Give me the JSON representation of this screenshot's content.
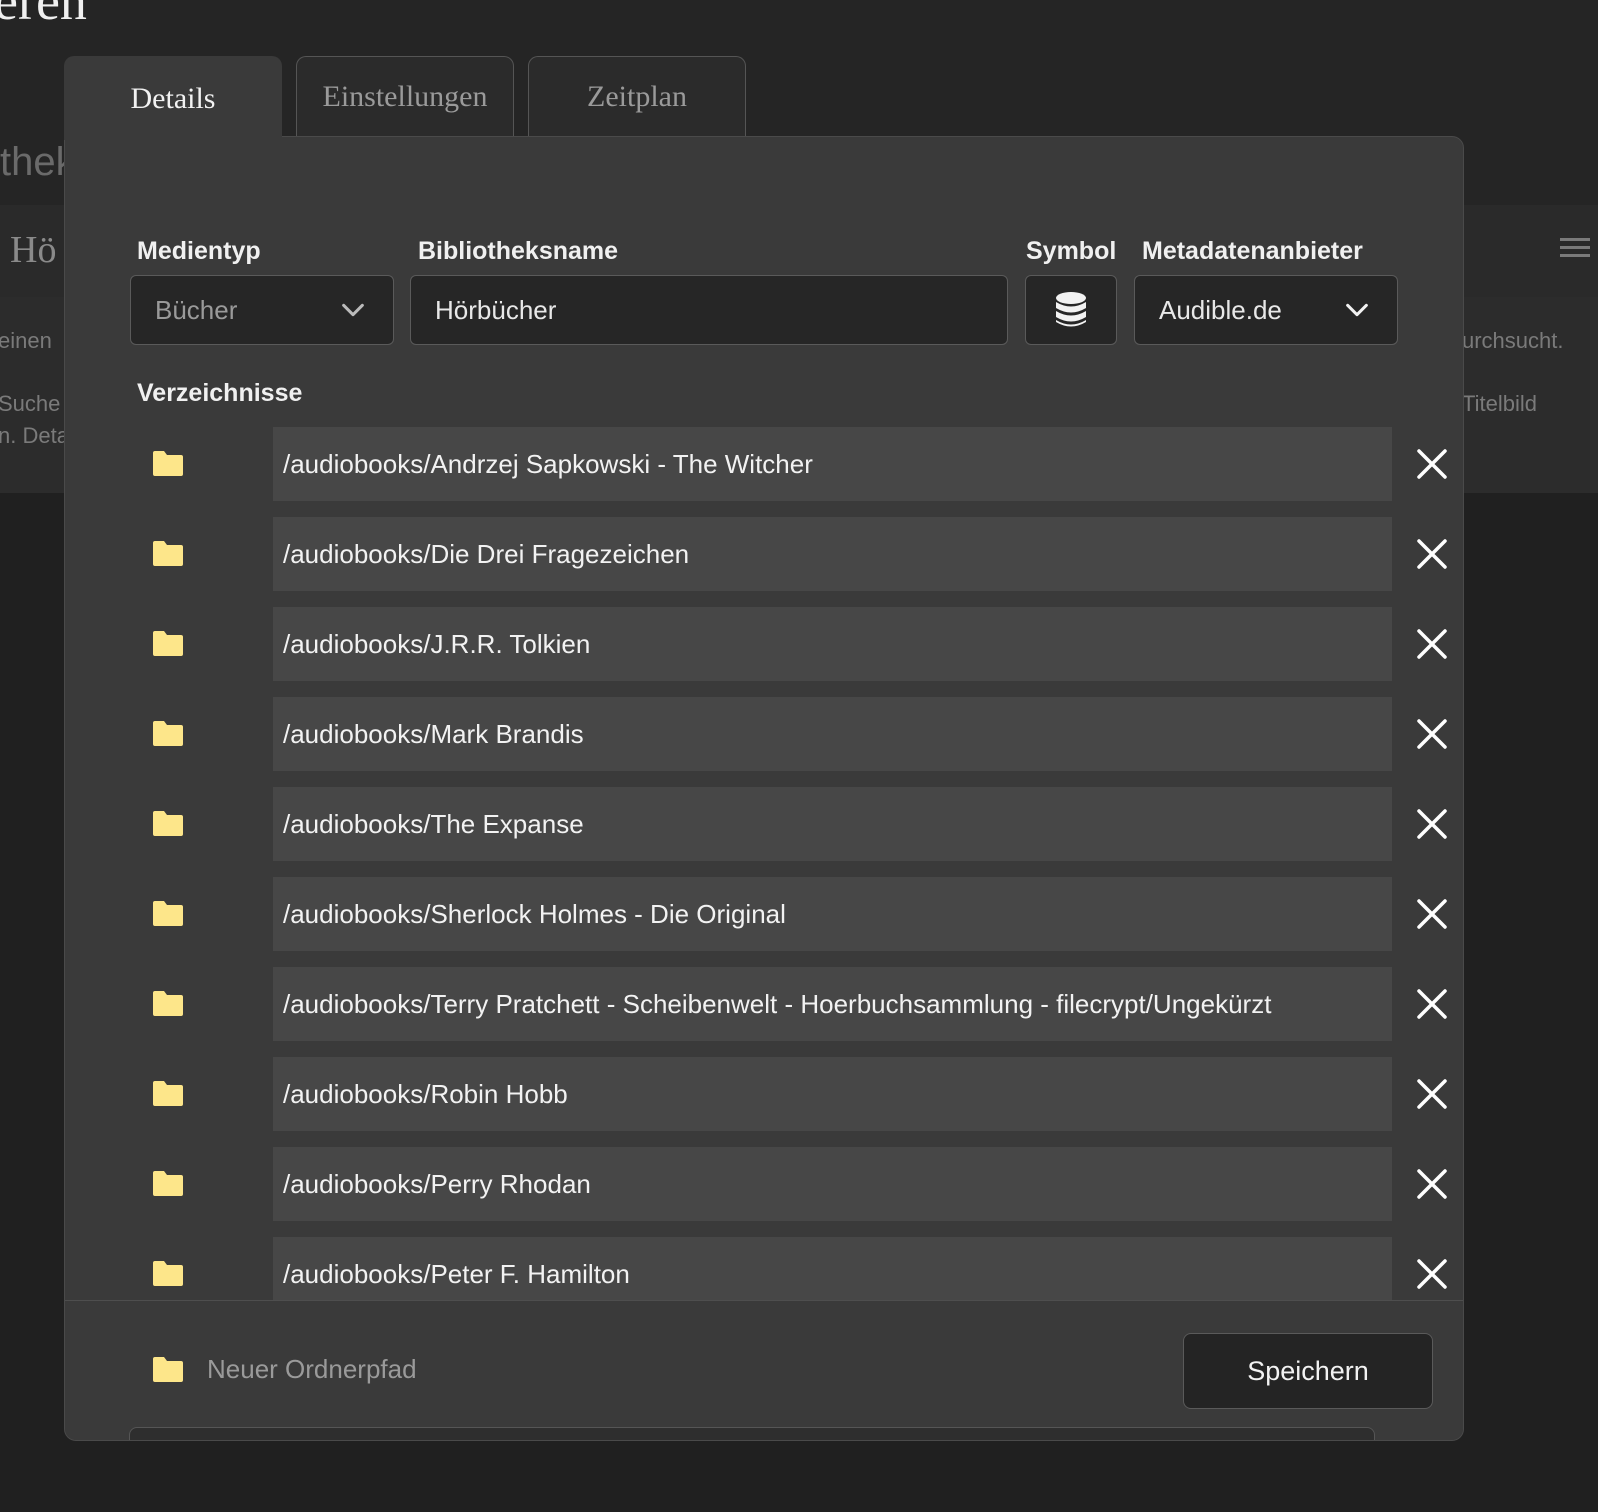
{
  "background": {
    "title": "eren",
    "subtitle": "thek",
    "row_label": "Hö",
    "text_left_1": "einen",
    "text_left_2": "Suche",
    "text_left_3": "n. Deta",
    "text_right_1": "urchsucht.",
    "text_right_2": "Titelbild"
  },
  "tabs": [
    {
      "label": "Details",
      "active": true
    },
    {
      "label": "Einstellungen",
      "active": false
    },
    {
      "label": "Zeitplan",
      "active": false
    }
  ],
  "form": {
    "media_type": {
      "label": "Medientyp",
      "value": "Bücher"
    },
    "library_name": {
      "label": "Bibliotheksname",
      "value": "Hörbücher"
    },
    "symbol": {
      "label": "Symbol",
      "icon": "database-icon"
    },
    "metadata_provider": {
      "label": "Metadatenanbieter",
      "value": "Audible.de"
    }
  },
  "directories": {
    "label": "Verzeichnisse",
    "items": [
      "/audiobooks/Andrzej Sapkowski - The Witcher",
      "/audiobooks/Die Drei Fragezeichen",
      "/audiobooks/J.R.R. Tolkien",
      "/audiobooks/Mark Brandis",
      "/audiobooks/The Expanse",
      "/audiobooks/Sherlock Holmes - Die Original",
      "/audiobooks/Terry Pratchett - Scheibenwelt - Hoerbuchsammlung - filecrypt/Ungekürzt",
      "/audiobooks/Robin Hobb",
      "/audiobooks/Perry Rhodan",
      "/audiobooks/Peter F. Hamilton"
    ]
  },
  "footer": {
    "new_path_placeholder": "Neuer Ordnerpfad",
    "save_label": "Speichern"
  },
  "colors": {
    "folder": "#fde68a",
    "page_bg": "#202020",
    "modal_bg": "#3a3a3a",
    "row_bg": "#474747"
  }
}
